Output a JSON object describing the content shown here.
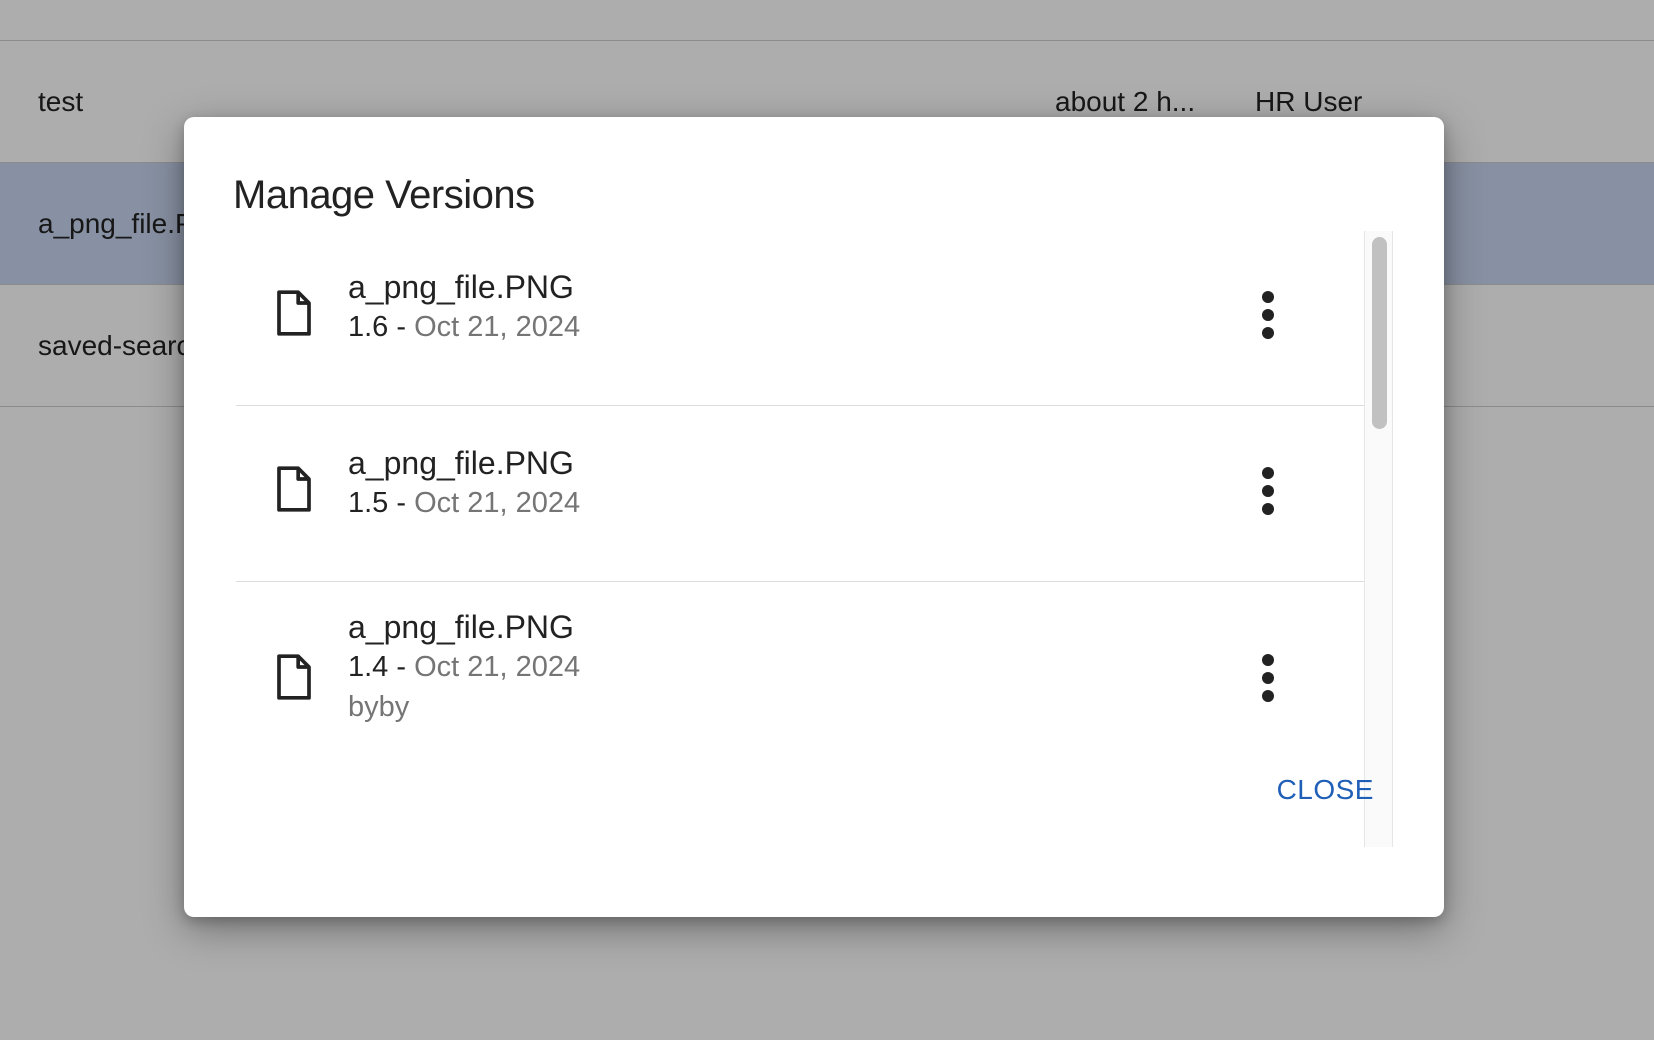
{
  "background_table": {
    "rows": [
      {
        "name": "test",
        "modified": "about 2 h...",
        "owner": "HR User",
        "selected": false
      },
      {
        "name": "a_png_file.PNG",
        "modified": "",
        "owner": "",
        "selected": true
      },
      {
        "name": "saved-search",
        "modified": "",
        "owner": "",
        "selected": false
      }
    ]
  },
  "dialog": {
    "title": "Manage Versions",
    "close_label": "CLOSE",
    "versions": [
      {
        "name": "a_png_file.PNG",
        "version": "1.6",
        "separator": " - ",
        "date": "Oct 21, 2024",
        "comment": ""
      },
      {
        "name": "a_png_file.PNG",
        "version": "1.5",
        "separator": " - ",
        "date": "Oct 21, 2024",
        "comment": ""
      },
      {
        "name": "a_png_file.PNG",
        "version": "1.4",
        "separator": " - ",
        "date": "Oct 21, 2024",
        "comment": "byby"
      }
    ],
    "icons": {
      "file": "file-outline-icon",
      "more": "more-vertical-icon"
    }
  },
  "colors": {
    "accent": "#1f5fb8",
    "selected_row": "#c9d6f0",
    "muted_text": "#757575",
    "scrim": "rgba(0,0,0,0.32)"
  }
}
